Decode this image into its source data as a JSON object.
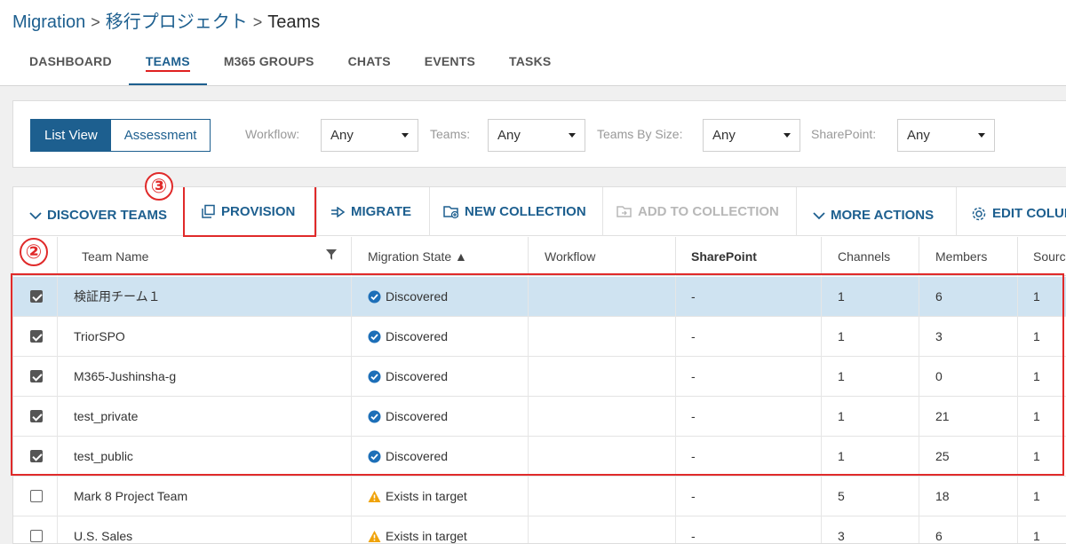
{
  "breadcrumb": {
    "root": "Migration",
    "project": "移行プロジェクト",
    "current": "Teams"
  },
  "tabs": [
    "DASHBOARD",
    "TEAMS",
    "M365 GROUPS",
    "CHATS",
    "EVENTS",
    "TASKS"
  ],
  "active_tab": "TEAMS",
  "view_toggle": {
    "list": "List View",
    "assessment": "Assessment",
    "selected": "List View"
  },
  "filters": {
    "workflow": {
      "label": "Workflow:",
      "value": "Any"
    },
    "teams": {
      "label": "Teams:",
      "value": "Any"
    },
    "teams_by_size": {
      "label": "Teams By Size:",
      "value": "Any"
    },
    "sharepoint": {
      "label": "SharePoint:",
      "value": "Any"
    }
  },
  "actions": {
    "discover": "DISCOVER TEAMS",
    "provision": "PROVISION",
    "migrate": "MIGRATE",
    "new_collection": "NEW COLLECTION",
    "add_to_collection": "ADD TO COLLECTION",
    "more_actions": "MORE ACTIONS",
    "edit_columns": "EDIT COLUMNS"
  },
  "columns": {
    "team_name": "Team Name",
    "migration_state": "Migration State ▲",
    "workflow": "Workflow",
    "sharepoint": "SharePoint",
    "channels": "Channels",
    "members": "Members",
    "source": "Source"
  },
  "rows": [
    {
      "checked": true,
      "selected": true,
      "name": "検証用チーム１",
      "state": "Discovered",
      "state_type": "ok",
      "workflow": "",
      "sharepoint": "-",
      "channels": "1",
      "members": "6",
      "source": "1"
    },
    {
      "checked": true,
      "selected": false,
      "name": "TriorSPO",
      "state": "Discovered",
      "state_type": "ok",
      "workflow": "",
      "sharepoint": "-",
      "channels": "1",
      "members": "3",
      "source": "1"
    },
    {
      "checked": true,
      "selected": false,
      "name": "M365-Jushinsha-g",
      "state": "Discovered",
      "state_type": "ok",
      "workflow": "",
      "sharepoint": "-",
      "channels": "1",
      "members": "0",
      "source": "1"
    },
    {
      "checked": true,
      "selected": false,
      "name": "test_private",
      "state": "Discovered",
      "state_type": "ok",
      "workflow": "",
      "sharepoint": "-",
      "channels": "1",
      "members": "21",
      "source": "1"
    },
    {
      "checked": true,
      "selected": false,
      "name": "test_public",
      "state": "Discovered",
      "state_type": "ok",
      "workflow": "",
      "sharepoint": "-",
      "channels": "1",
      "members": "25",
      "source": "1"
    },
    {
      "checked": false,
      "selected": false,
      "name": "Mark 8 Project Team",
      "state": "Exists in target",
      "state_type": "warn",
      "workflow": "",
      "sharepoint": "-",
      "channels": "5",
      "members": "18",
      "source": "1"
    },
    {
      "checked": false,
      "selected": false,
      "name": "U.S. Sales",
      "state": "Exists in target",
      "state_type": "warn",
      "workflow": "",
      "sharepoint": "-",
      "channels": "3",
      "members": "6",
      "source": "1"
    }
  ],
  "annotations": {
    "step2": "②",
    "step3": "③"
  },
  "colors": {
    "accent": "#1d5f8f",
    "selected_row": "#cfe3f1",
    "annotation": "#e02a2a",
    "ok_icon": "#1d6fb8",
    "warn_icon": "#f0a30a"
  }
}
